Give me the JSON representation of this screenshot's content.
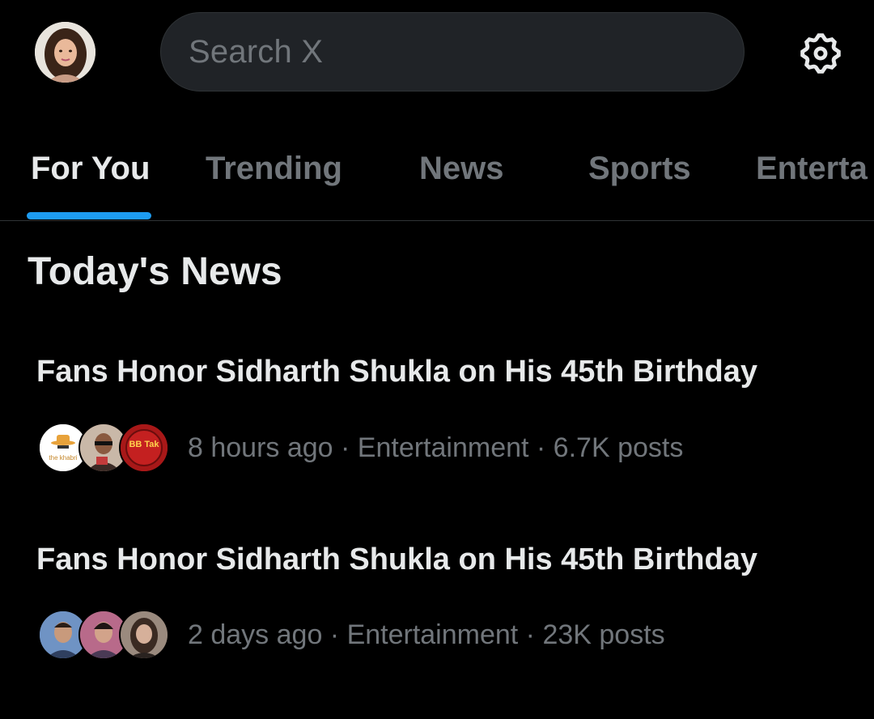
{
  "header": {
    "search_placeholder": "Search X",
    "avatar_icon": "profile-avatar",
    "settings_icon": "gear-icon"
  },
  "tabs": [
    {
      "label": "For You",
      "active": true
    },
    {
      "label": "Trending",
      "active": false
    },
    {
      "label": "News",
      "active": false
    },
    {
      "label": "Sports",
      "active": false
    },
    {
      "label": "Enterta",
      "active": false
    }
  ],
  "section": {
    "title": "Today's News"
  },
  "stories": [
    {
      "title": "Fans Honor Sidharth Shukla on His 45th Birthday",
      "meta": "8 hours ago · Entertainment · 6.7K posts",
      "avatar_labels": [
        "the khabri",
        "",
        "BB Tak"
      ]
    },
    {
      "title": "Fans Honor Sidharth Shukla on His 45th Birthday",
      "meta": "2 days ago · Entertainment · 23K posts",
      "avatar_labels": [
        "",
        "",
        ""
      ]
    }
  ],
  "colors": {
    "accent": "#1d9bf0",
    "background": "#000000",
    "text_primary": "#e7e9ea",
    "text_secondary": "#71767b"
  }
}
